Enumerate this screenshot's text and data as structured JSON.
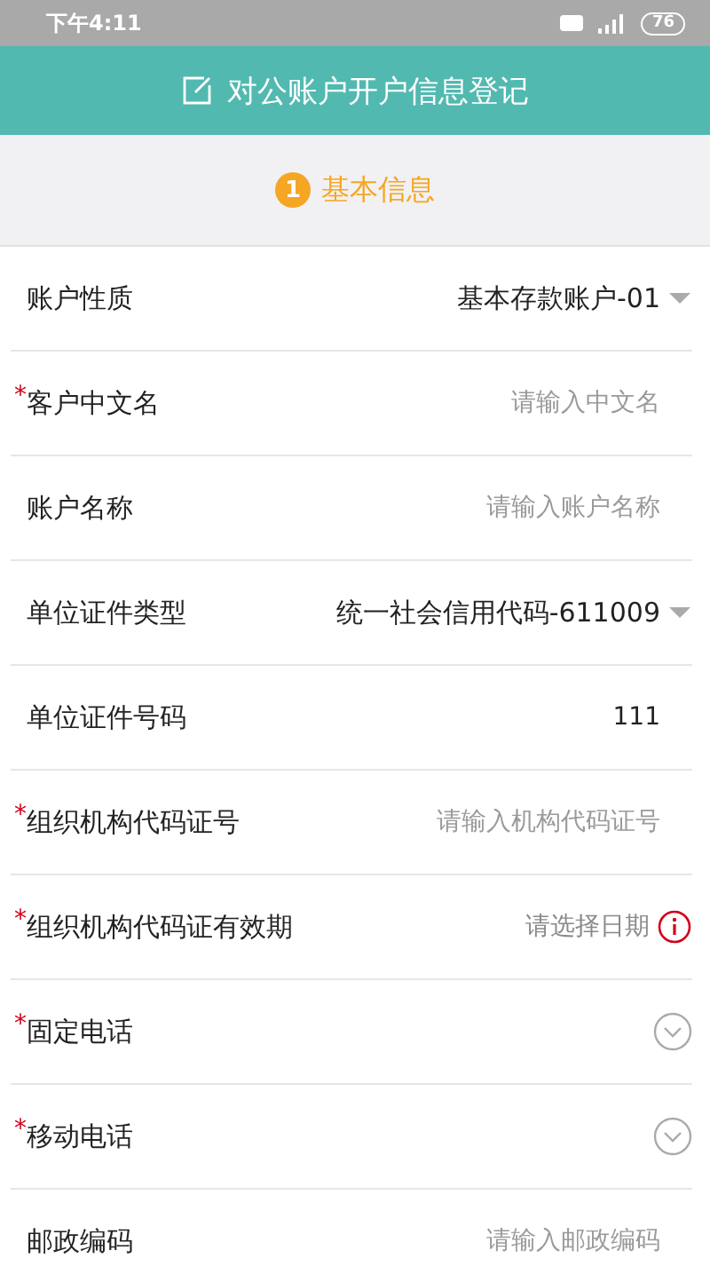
{
  "status_bar": {
    "time": "下午4:11",
    "battery": "76"
  },
  "title": "对公账户开户信息登记",
  "section": {
    "step": "1",
    "title": "基本信息"
  },
  "rows": [
    {
      "kind": "select",
      "label": "账户性质",
      "value": "基本存款账户-01"
    },
    {
      "kind": "input",
      "required_mark": "*",
      "label": "客户中文名",
      "placeholder": "请输入中文名"
    },
    {
      "kind": "input",
      "label": "账户名称",
      "placeholder": "请输入账户名称"
    },
    {
      "kind": "select",
      "label": "单位证件类型",
      "value": "统一社会信用代码-611009"
    },
    {
      "kind": "input",
      "label": "单位证件号码",
      "value": "111"
    },
    {
      "kind": "input",
      "required_mark": "*",
      "label": "组织机构代码证号",
      "placeholder": "请输入机构代码证号"
    },
    {
      "kind": "date",
      "required_mark": "*",
      "label": "组织机构代码证有效期",
      "placeholder": "请选择日期"
    },
    {
      "kind": "expand",
      "required_mark": "*",
      "label": "固定电话"
    },
    {
      "kind": "expand",
      "required_mark": "*",
      "label": "移动电话"
    },
    {
      "kind": "input",
      "label": "邮政编码",
      "placeholder": "请输入邮政编码"
    }
  ]
}
